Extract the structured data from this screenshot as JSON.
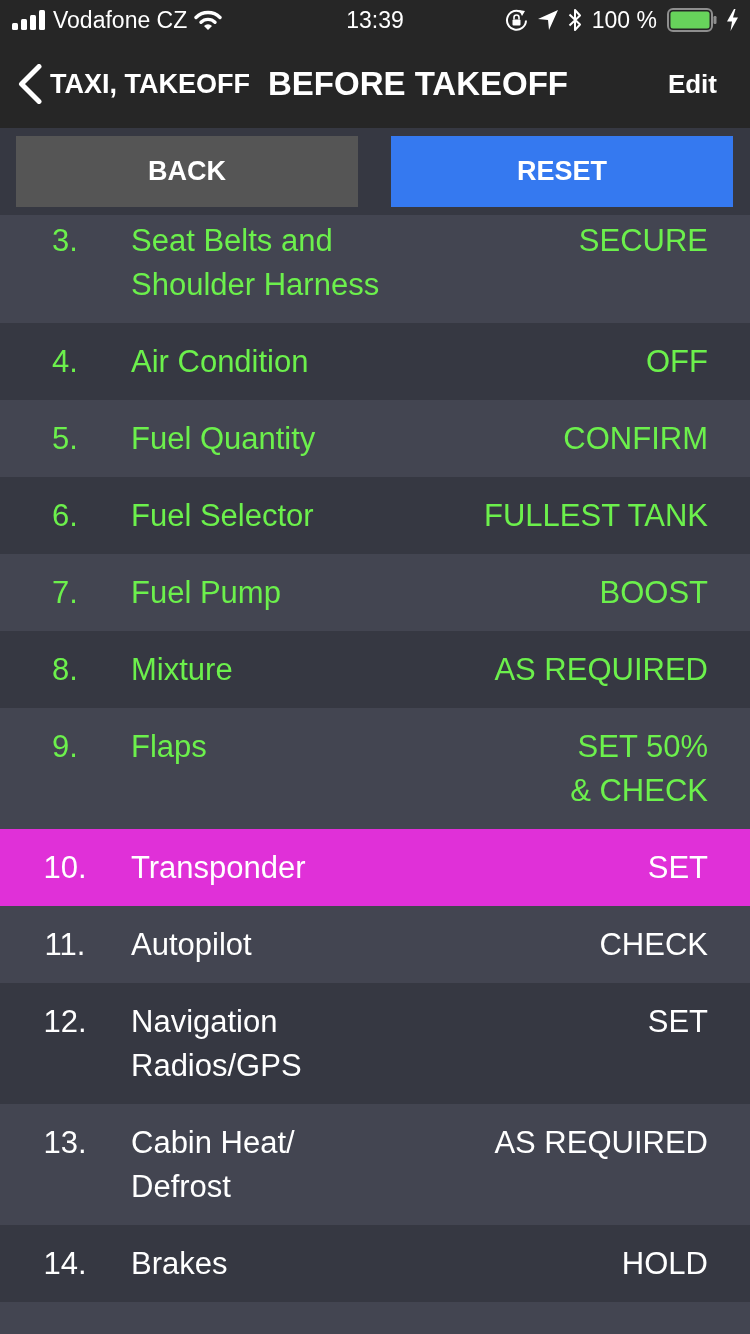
{
  "status_bar": {
    "carrier": "Vodafone CZ",
    "time": "13:39",
    "battery": "100 %"
  },
  "nav_bar": {
    "back": "TAXI, TAKEOFF",
    "title": "BEFORE TAKEOFF",
    "action": "Edit"
  },
  "buttons": [
    {
      "label": "BACK",
      "kind": "secondary"
    },
    {
      "label": "RESET",
      "kind": "primary"
    }
  ],
  "items": [
    {
      "number": "3.",
      "name": "Seat Belts and Shoulder Harness",
      "value": "SECURE",
      "checked": true,
      "selected": false
    },
    {
      "number": "4.",
      "name": "Air Condition",
      "value": "OFF",
      "checked": true,
      "selected": false
    },
    {
      "number": "5.",
      "name": "Fuel Quantity",
      "value": "CONFIRM",
      "checked": true,
      "selected": false
    },
    {
      "number": "6.",
      "name": "Fuel Selector",
      "value": "FULLEST TANK",
      "checked": true,
      "selected": false
    },
    {
      "number": "7.",
      "name": "Fuel Pump",
      "value": "BOOST",
      "checked": true,
      "selected": false
    },
    {
      "number": "8.",
      "name": "Mixture",
      "value": "AS REQUIRED",
      "checked": true,
      "selected": false
    },
    {
      "number": "9.",
      "name": "Flaps",
      "value": "SET 50% & CHECK",
      "checked": true,
      "selected": false
    },
    {
      "number": "10.",
      "name": "Transponder",
      "value": "SET",
      "checked": false,
      "selected": true
    },
    {
      "number": "11.",
      "name": "Autopilot",
      "value": "CHECK",
      "checked": false,
      "selected": false
    },
    {
      "number": "12.",
      "name": "Navigation Radios/GPS",
      "value": "SET",
      "checked": false,
      "selected": false
    },
    {
      "number": "13.",
      "name": "Cabin Heat/ Defrost",
      "value": "AS REQUIRED",
      "checked": false,
      "selected": false
    },
    {
      "number": "14.",
      "name": "Brakes",
      "value": "HOLD",
      "checked": false,
      "selected": false
    }
  ]
}
